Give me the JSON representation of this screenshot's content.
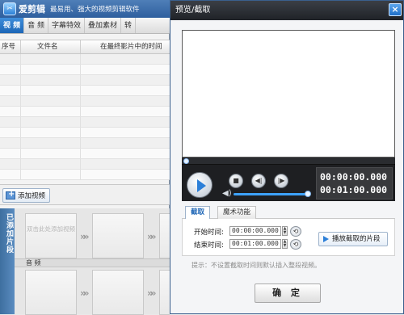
{
  "app": {
    "title": "爱剪辑",
    "subtitle": "最易用、强大的视频剪辑软件",
    "logo_icon": "app-logo-icon"
  },
  "tabs": [
    {
      "label": "视  频",
      "active": true
    },
    {
      "label": "音  频",
      "active": false
    },
    {
      "label": "字幕特效",
      "active": false
    },
    {
      "label": "叠加素材",
      "active": false
    },
    {
      "label": "转",
      "active": false
    }
  ],
  "table": {
    "columns": [
      "序号",
      "文件名",
      "在最终影片中的时间"
    ]
  },
  "add_video": {
    "label": "添加视频"
  },
  "clips": {
    "side_label": "已添加片段",
    "hint": "双击此处添加视频",
    "audio_label": "音  频"
  },
  "dialog": {
    "title": "预览/截取",
    "close_icon": "close-icon",
    "timecode_current": "00:00:00.000",
    "timecode_total": "00:01:00.000",
    "tabs": [
      {
        "label": "截取",
        "active": true
      },
      {
        "label": "魔术功能",
        "active": false
      }
    ],
    "start_label": "开始时间:",
    "start_value": "00:00:00.000",
    "end_label": "结束时间:",
    "end_value": "00:01:00.000",
    "play_selection_label": "播放截取的片段",
    "tip": "提示：不设置截取时间则默认插入整段视频。",
    "ok_label": "确  定"
  },
  "colors": {
    "titlebar": "#2e5f9e",
    "active_tab": "#1b64b5",
    "dialog_titlebar": "#1f2227",
    "player_bg": "#1e1f22",
    "accent": "#2c7fd8"
  }
}
